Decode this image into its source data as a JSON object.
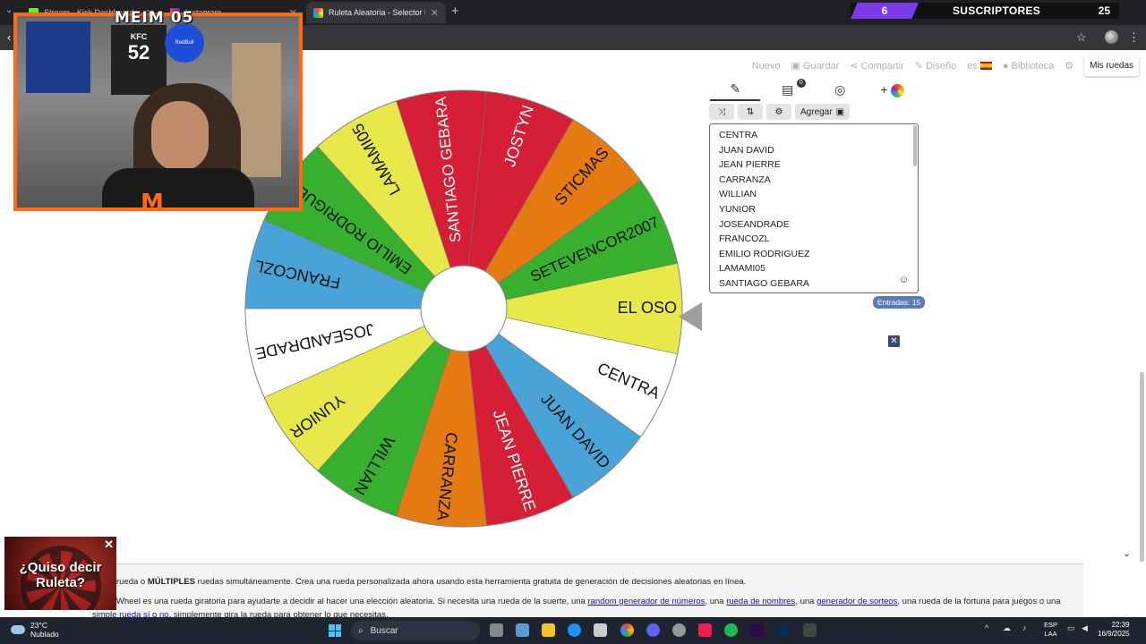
{
  "browser": {
    "tabs": [
      {
        "label": "Stream - Kick Dashboard",
        "active": false
      },
      {
        "label": "Instagram",
        "active": false
      },
      {
        "label": "Ruleta Aleatoria - Selector Pers",
        "active": true
      }
    ],
    "new_tab_icon": "plus-icon"
  },
  "stream_overlay": {
    "subscribers_count": "6",
    "subscribers_label": "SUSCRIPTORES",
    "subscribers_goal": "25",
    "cam_title": "MEIM 05",
    "cam_shirt_text": "KFC",
    "cam_shirt_number": "52",
    "cam_ball_text": "RedBull",
    "cam_logo": "M"
  },
  "site_nav": {
    "nuevo": "Nuevo",
    "guardar": "Guardar",
    "compartir": "Compartir",
    "diseno": "Diseño",
    "lang": "es",
    "biblioteca": "Biblioteca",
    "mis_ruedas": "Mis ruedas"
  },
  "wheel": {
    "segments": [
      {
        "label": "EL OSO",
        "color": "#e8e84a",
        "text": "#111111"
      },
      {
        "label": "CENTRA",
        "color": "#ffffff",
        "text": "#111111"
      },
      {
        "label": "JUAN DAVID",
        "color": "#4aa3d6",
        "text": "#111111"
      },
      {
        "label": "JEAN PIERRE",
        "color": "#d61f36",
        "text": "#ffffff"
      },
      {
        "label": "CARRANZA",
        "color": "#e67a12",
        "text": "#111111"
      },
      {
        "label": "WILLIAN",
        "color": "#36b02e",
        "text": "#111111"
      },
      {
        "label": "YUNIOR",
        "color": "#e8e84a",
        "text": "#111111"
      },
      {
        "label": "JOSEANDRADE",
        "color": "#ffffff",
        "text": "#111111"
      },
      {
        "label": "FRANCOZL",
        "color": "#4aa3d6",
        "text": "#111111"
      },
      {
        "label": "EMILIO RODRIGUEZ",
        "color": "#36b02e",
        "text": "#111111"
      },
      {
        "label": "LAMAMI05",
        "color": "#e8e84a",
        "text": "#111111"
      },
      {
        "label": "SANTIAGO GEBARA",
        "color": "#d61f36",
        "text": "#ffffff"
      },
      {
        "label": "JOSTYN",
        "color": "#d61f36",
        "text": "#ffffff"
      },
      {
        "label": "STICMAS",
        "color": "#e67a12",
        "text": "#111111"
      },
      {
        "label": "SETEVENCOR2007",
        "color": "#36b02e",
        "text": "#111111"
      }
    ]
  },
  "editor": {
    "tabs": [
      "edit-icon",
      "clipboard-icon",
      "hide-icon",
      "add-color-icon"
    ],
    "results_badge": "0",
    "add_button": "Agregar",
    "entries": [
      "CENTRA",
      "JUAN DAVID",
      "JEAN PIERRE",
      "CARRANZA",
      "WILLIAN",
      "YUNIOR",
      "JOSEANDRADE",
      "FRANCOZL",
      "EMILIO RODRIGUEZ",
      "LAMAMI05",
      "SANTIAGO GEBARA"
    ],
    "entries_count": "Entradas: 15"
  },
  "description": {
    "line1_pre": "rueda o ",
    "line1_bold": "MÚLTIPLES",
    "line1_post": " ruedas simultáneamente. Crea una rueda personalizada ahora usando esta herramienta gratuita de generación de decisiones aleatorias en línea.",
    "line2_pre": "e Wheel es una rueda giratoria para ayudarte a decidir al hacer una elección aleatoria. Si necesita una rueda de la suerte, una ",
    "link_numeros": "random generador de números",
    "line2_mid1": ", una ",
    "link_nombres": "rueda de nombres",
    "line2_mid2": ", una ",
    "link_sorteos": "generador de sorteos",
    "line2_post": ", una rueda de la fortuna para juegos o una",
    "line3_pre": "simple ",
    "link_sino": "rueda sí o no",
    "line3_post": ", simplemente gira la rueda para obtener lo que necesitas."
  },
  "promo": {
    "text": "¿Quiso decir Ruleta?"
  },
  "taskbar": {
    "temp": "23°C",
    "weather": "Nublado",
    "search": "Buscar",
    "lang1": "ESP",
    "lang2": "LAA",
    "time": "22:39",
    "date": "16/9/2025"
  }
}
